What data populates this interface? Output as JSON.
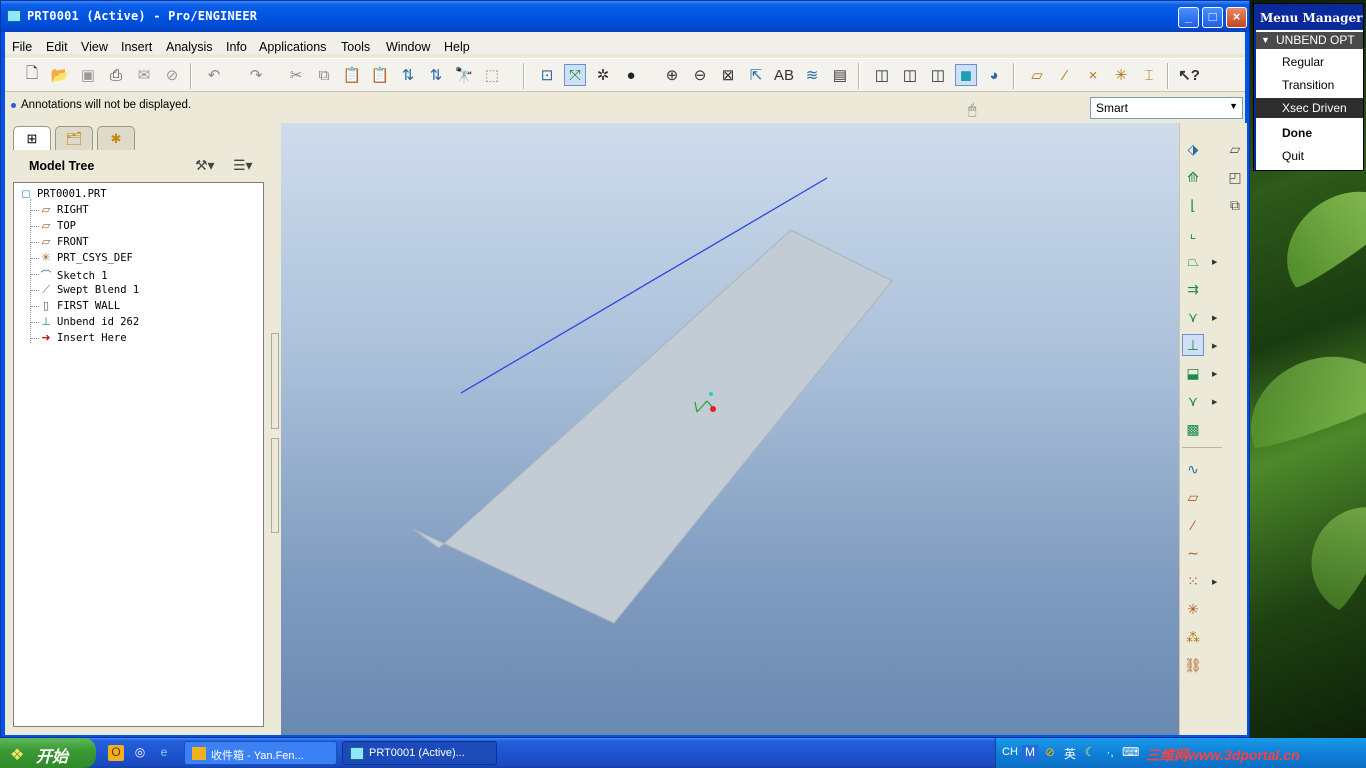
{
  "window": {
    "title": "PRT0001 (Active) - Pro/ENGINEER",
    "minimize": "_",
    "maximize": "□",
    "close": "×"
  },
  "menubar": [
    "File",
    "Edit",
    "View",
    "Insert",
    "Analysis",
    "Info",
    "Applications",
    "Tools",
    "Window",
    "Help"
  ],
  "message": "Annotations will not be displayed.",
  "filter": {
    "value": "Smart"
  },
  "model_tree": {
    "title": "Model Tree",
    "items": [
      {
        "label": "PRT0001.PRT",
        "icon": "part-icon"
      },
      {
        "label": "RIGHT",
        "icon": "datum-plane-icon"
      },
      {
        "label": "TOP",
        "icon": "datum-plane-icon"
      },
      {
        "label": "FRONT",
        "icon": "datum-plane-icon"
      },
      {
        "label": "PRT_CSYS_DEF",
        "icon": "csys-icon"
      },
      {
        "label": "Sketch 1",
        "icon": "sketch-icon"
      },
      {
        "label": "Swept Blend 1",
        "icon": "swept-blend-icon"
      },
      {
        "label": "FIRST WALL",
        "icon": "wall-icon"
      },
      {
        "label": "Unbend id 262",
        "icon": "unbend-icon"
      },
      {
        "label": "Insert Here",
        "icon": "insert-here-arrow-icon"
      }
    ]
  },
  "menu_manager": {
    "title": "Menu Manager",
    "header": "UNBEND OPT",
    "options": [
      "Regular",
      "Transition",
      "Xsec Driven"
    ],
    "selected": "Xsec Driven",
    "done": "Done",
    "quit": "Quit"
  },
  "taskbar": {
    "start": "开始",
    "tasks": [
      "收件箱 - Yan.Fen...",
      "PRT0001 (Active)..."
    ],
    "tray_lang": "CH",
    "tray_ime": "英",
    "watermark": "三维网www.3dportal.cn"
  },
  "colors": {
    "title_bar": "#0054e3",
    "viewport_top": "#cfdcec",
    "viewport_bottom": "#6a89b1",
    "part_surface": "#c3ccd4",
    "sketch_line": "#2a44e6",
    "menu_selected": "#2e2e2e"
  }
}
